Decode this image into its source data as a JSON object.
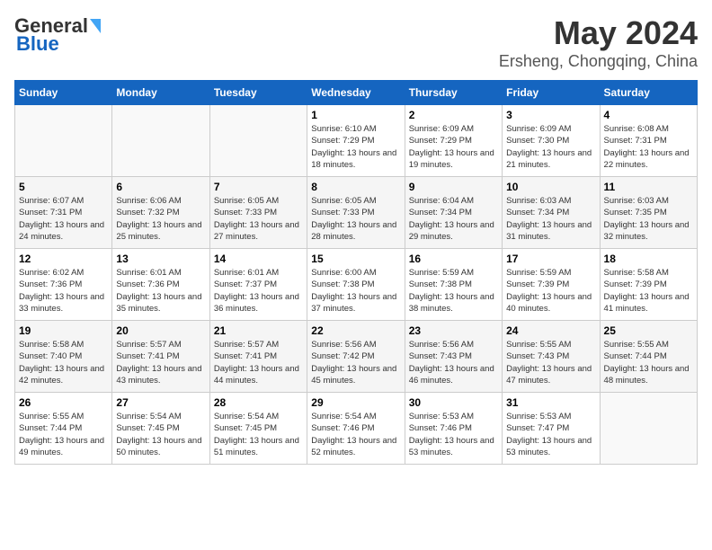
{
  "logo": {
    "part1": "General",
    "part2": "Blue"
  },
  "header": {
    "month": "May 2024",
    "location": "Ersheng, Chongqing, China"
  },
  "weekdays": [
    "Sunday",
    "Monday",
    "Tuesday",
    "Wednesday",
    "Thursday",
    "Friday",
    "Saturday"
  ],
  "weeks": [
    [
      {
        "day": "",
        "sunrise": "",
        "sunset": "",
        "daylight": ""
      },
      {
        "day": "",
        "sunrise": "",
        "sunset": "",
        "daylight": ""
      },
      {
        "day": "",
        "sunrise": "",
        "sunset": "",
        "daylight": ""
      },
      {
        "day": "1",
        "sunrise": "Sunrise: 6:10 AM",
        "sunset": "Sunset: 7:29 PM",
        "daylight": "Daylight: 13 hours and 18 minutes."
      },
      {
        "day": "2",
        "sunrise": "Sunrise: 6:09 AM",
        "sunset": "Sunset: 7:29 PM",
        "daylight": "Daylight: 13 hours and 19 minutes."
      },
      {
        "day": "3",
        "sunrise": "Sunrise: 6:09 AM",
        "sunset": "Sunset: 7:30 PM",
        "daylight": "Daylight: 13 hours and 21 minutes."
      },
      {
        "day": "4",
        "sunrise": "Sunrise: 6:08 AM",
        "sunset": "Sunset: 7:31 PM",
        "daylight": "Daylight: 13 hours and 22 minutes."
      }
    ],
    [
      {
        "day": "5",
        "sunrise": "Sunrise: 6:07 AM",
        "sunset": "Sunset: 7:31 PM",
        "daylight": "Daylight: 13 hours and 24 minutes."
      },
      {
        "day": "6",
        "sunrise": "Sunrise: 6:06 AM",
        "sunset": "Sunset: 7:32 PM",
        "daylight": "Daylight: 13 hours and 25 minutes."
      },
      {
        "day": "7",
        "sunrise": "Sunrise: 6:05 AM",
        "sunset": "Sunset: 7:33 PM",
        "daylight": "Daylight: 13 hours and 27 minutes."
      },
      {
        "day": "8",
        "sunrise": "Sunrise: 6:05 AM",
        "sunset": "Sunset: 7:33 PM",
        "daylight": "Daylight: 13 hours and 28 minutes."
      },
      {
        "day": "9",
        "sunrise": "Sunrise: 6:04 AM",
        "sunset": "Sunset: 7:34 PM",
        "daylight": "Daylight: 13 hours and 29 minutes."
      },
      {
        "day": "10",
        "sunrise": "Sunrise: 6:03 AM",
        "sunset": "Sunset: 7:34 PM",
        "daylight": "Daylight: 13 hours and 31 minutes."
      },
      {
        "day": "11",
        "sunrise": "Sunrise: 6:03 AM",
        "sunset": "Sunset: 7:35 PM",
        "daylight": "Daylight: 13 hours and 32 minutes."
      }
    ],
    [
      {
        "day": "12",
        "sunrise": "Sunrise: 6:02 AM",
        "sunset": "Sunset: 7:36 PM",
        "daylight": "Daylight: 13 hours and 33 minutes."
      },
      {
        "day": "13",
        "sunrise": "Sunrise: 6:01 AM",
        "sunset": "Sunset: 7:36 PM",
        "daylight": "Daylight: 13 hours and 35 minutes."
      },
      {
        "day": "14",
        "sunrise": "Sunrise: 6:01 AM",
        "sunset": "Sunset: 7:37 PM",
        "daylight": "Daylight: 13 hours and 36 minutes."
      },
      {
        "day": "15",
        "sunrise": "Sunrise: 6:00 AM",
        "sunset": "Sunset: 7:38 PM",
        "daylight": "Daylight: 13 hours and 37 minutes."
      },
      {
        "day": "16",
        "sunrise": "Sunrise: 5:59 AM",
        "sunset": "Sunset: 7:38 PM",
        "daylight": "Daylight: 13 hours and 38 minutes."
      },
      {
        "day": "17",
        "sunrise": "Sunrise: 5:59 AM",
        "sunset": "Sunset: 7:39 PM",
        "daylight": "Daylight: 13 hours and 40 minutes."
      },
      {
        "day": "18",
        "sunrise": "Sunrise: 5:58 AM",
        "sunset": "Sunset: 7:39 PM",
        "daylight": "Daylight: 13 hours and 41 minutes."
      }
    ],
    [
      {
        "day": "19",
        "sunrise": "Sunrise: 5:58 AM",
        "sunset": "Sunset: 7:40 PM",
        "daylight": "Daylight: 13 hours and 42 minutes."
      },
      {
        "day": "20",
        "sunrise": "Sunrise: 5:57 AM",
        "sunset": "Sunset: 7:41 PM",
        "daylight": "Daylight: 13 hours and 43 minutes."
      },
      {
        "day": "21",
        "sunrise": "Sunrise: 5:57 AM",
        "sunset": "Sunset: 7:41 PM",
        "daylight": "Daylight: 13 hours and 44 minutes."
      },
      {
        "day": "22",
        "sunrise": "Sunrise: 5:56 AM",
        "sunset": "Sunset: 7:42 PM",
        "daylight": "Daylight: 13 hours and 45 minutes."
      },
      {
        "day": "23",
        "sunrise": "Sunrise: 5:56 AM",
        "sunset": "Sunset: 7:43 PM",
        "daylight": "Daylight: 13 hours and 46 minutes."
      },
      {
        "day": "24",
        "sunrise": "Sunrise: 5:55 AM",
        "sunset": "Sunset: 7:43 PM",
        "daylight": "Daylight: 13 hours and 47 minutes."
      },
      {
        "day": "25",
        "sunrise": "Sunrise: 5:55 AM",
        "sunset": "Sunset: 7:44 PM",
        "daylight": "Daylight: 13 hours and 48 minutes."
      }
    ],
    [
      {
        "day": "26",
        "sunrise": "Sunrise: 5:55 AM",
        "sunset": "Sunset: 7:44 PM",
        "daylight": "Daylight: 13 hours and 49 minutes."
      },
      {
        "day": "27",
        "sunrise": "Sunrise: 5:54 AM",
        "sunset": "Sunset: 7:45 PM",
        "daylight": "Daylight: 13 hours and 50 minutes."
      },
      {
        "day": "28",
        "sunrise": "Sunrise: 5:54 AM",
        "sunset": "Sunset: 7:45 PM",
        "daylight": "Daylight: 13 hours and 51 minutes."
      },
      {
        "day": "29",
        "sunrise": "Sunrise: 5:54 AM",
        "sunset": "Sunset: 7:46 PM",
        "daylight": "Daylight: 13 hours and 52 minutes."
      },
      {
        "day": "30",
        "sunrise": "Sunrise: 5:53 AM",
        "sunset": "Sunset: 7:46 PM",
        "daylight": "Daylight: 13 hours and 53 minutes."
      },
      {
        "day": "31",
        "sunrise": "Sunrise: 5:53 AM",
        "sunset": "Sunset: 7:47 PM",
        "daylight": "Daylight: 13 hours and 53 minutes."
      },
      {
        "day": "",
        "sunrise": "",
        "sunset": "",
        "daylight": ""
      }
    ]
  ]
}
